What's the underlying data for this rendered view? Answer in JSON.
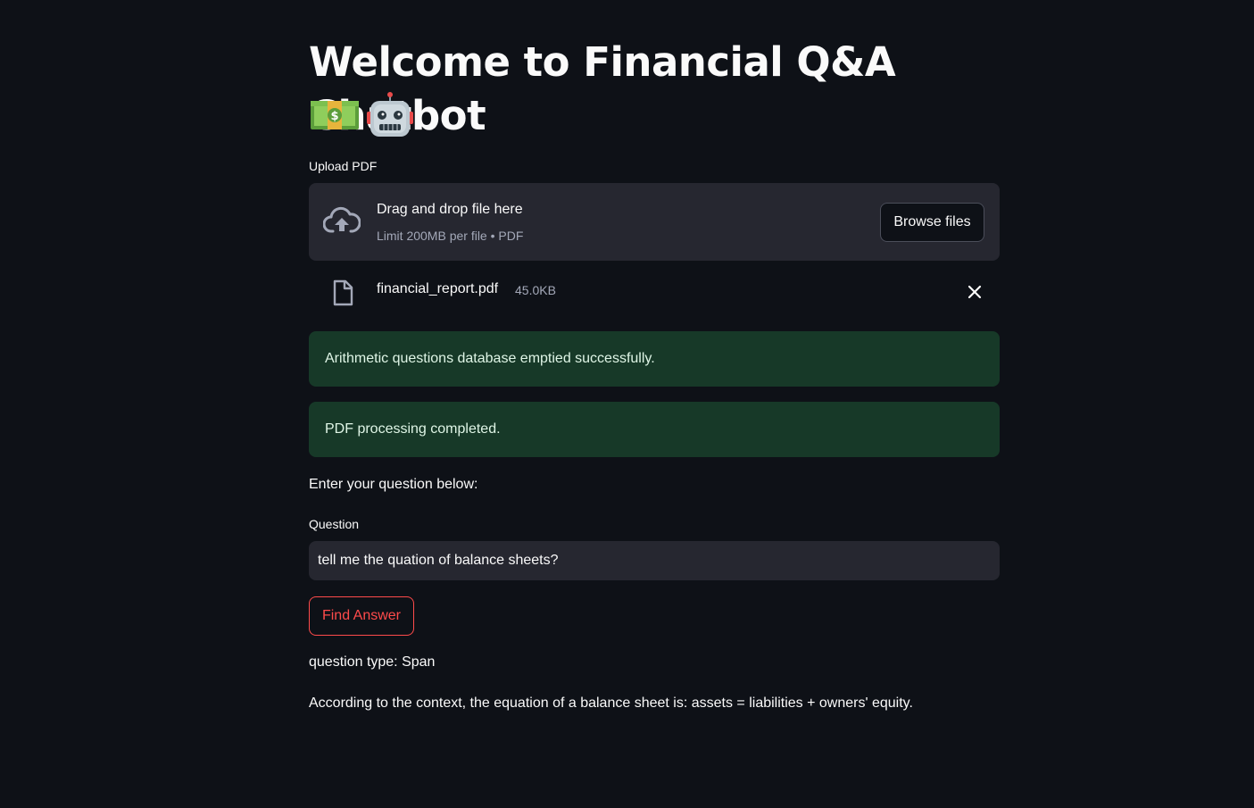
{
  "title": "Welcome to Financial Q&A Chatbot",
  "title_icons": [
    "money-icon",
    "robot-icon"
  ],
  "uploader": {
    "label": "Upload PDF",
    "drop_title": "Drag and drop file here",
    "drop_subtitle": "Limit 200MB per file • PDF",
    "browse_label": "Browse files"
  },
  "uploaded_file": {
    "name": "financial_report.pdf",
    "size": "45.0KB"
  },
  "alerts": [
    "Arithmetic questions database emptied successfully.",
    "PDF processing completed."
  ],
  "prompt_text": "Enter your question below:",
  "question": {
    "label": "Question",
    "value": "tell me the quation of balance sheets?"
  },
  "find_button_label": "Find Answer",
  "question_type": "question type: Span",
  "answer": "According to the context, the equation of a balance sheet is: assets = liabilities + owners' equity.",
  "colors": {
    "background": "#0e1117",
    "widget": "#262730",
    "success_bg": "#173928",
    "primary": "#ff4b4b"
  }
}
